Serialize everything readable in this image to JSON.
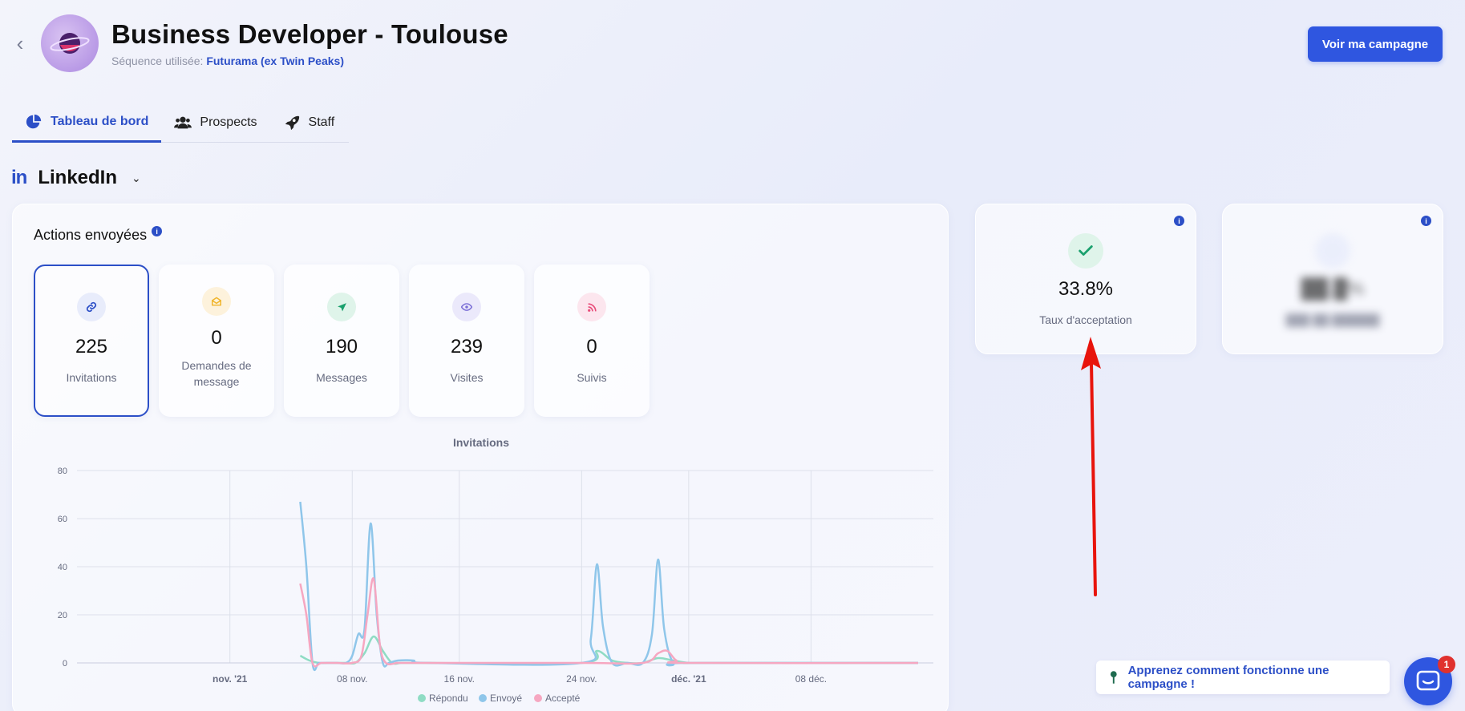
{
  "header": {
    "title": "Business Developer - Toulouse",
    "sequence_label": "Séquence utilisée:",
    "sequence_name": "Futurama (ex Twin Peaks)",
    "campaign_button": "Voir ma campagne"
  },
  "tabs": [
    {
      "label": "Tableau de bord",
      "icon": "pie-chart-icon",
      "active": true
    },
    {
      "label": "Prospects",
      "icon": "users-icon",
      "active": false
    },
    {
      "label": "Staff",
      "icon": "rocket-icon",
      "active": false
    }
  ],
  "channel": {
    "logo": "in",
    "name": "LinkedIn"
  },
  "actions": {
    "title": "Actions envoyées",
    "info": "i",
    "stats": [
      {
        "value": "225",
        "label": "Invitations",
        "icon": "link-icon",
        "color": "#2c4fc7"
      },
      {
        "value": "0",
        "label": "Demandes de message",
        "icon": "envelope-icon",
        "color": "#f0b429"
      },
      {
        "value": "190",
        "label": "Messages",
        "icon": "send-icon",
        "color": "#1aa06d"
      },
      {
        "value": "239",
        "label": "Visites",
        "icon": "eye-icon",
        "color": "#7b6fd6"
      },
      {
        "value": "0",
        "label": "Suivis",
        "icon": "rss-icon",
        "color": "#e84d7a"
      }
    ]
  },
  "kpis": [
    {
      "value": "33.8%",
      "label": "Taux d'acceptation",
      "icon": "check-icon"
    }
  ],
  "help": {
    "text": "Apprenez comment fonctionne une campagne !",
    "icon": "pin-icon"
  },
  "chat": {
    "badge": "1"
  },
  "colors": {
    "accent": "#2f56e0",
    "repondu": "#8fdcc4",
    "envoye": "#8fc6ea",
    "accepte": "#f6a7c1"
  },
  "chart_data": {
    "type": "line",
    "title": "Invitations",
    "ylim": [
      0,
      80
    ],
    "yticks": [
      0,
      20,
      40,
      60,
      80
    ],
    "xlim": [
      -10,
      46
    ],
    "x_ticks": [
      {
        "x": 0,
        "label": "nov. '21",
        "bold": true
      },
      {
        "x": 8,
        "label": "08 nov.",
        "bold": false
      },
      {
        "x": 15,
        "label": "16 nov.",
        "bold": false
      },
      {
        "x": 23,
        "label": "24 nov.",
        "bold": false
      },
      {
        "x": 30,
        "label": "déc. '21",
        "bold": true
      },
      {
        "x": 38,
        "label": "08 déc.",
        "bold": false
      }
    ],
    "x_day_labels": [
      "nov. '21",
      "08 nov.",
      "16 nov.",
      "24 nov.",
      "déc. '21",
      "08 déc."
    ],
    "series": [
      {
        "name": "Répondu",
        "color": "#8fdcc4",
        "x": [
          4.6,
          5.2,
          5.8,
          6.4,
          7.0,
          7.6,
          8.2,
          8.8,
          9.4,
          10.0,
          10.6,
          11.2,
          11.8,
          12.4,
          13.0,
          23.0,
          24.0,
          25.0,
          26.0,
          27.0,
          28.0,
          29.0,
          30.0,
          31.0,
          45.0
        ],
        "y": [
          3,
          1,
          0,
          0,
          0,
          0,
          0,
          4,
          11,
          5,
          0,
          0,
          0,
          0,
          0,
          0,
          5,
          1,
          0,
          0,
          2,
          1,
          0,
          0,
          0
        ]
      },
      {
        "name": "Envoyé",
        "color": "#8fc6ea",
        "x": [
          4.6,
          5.0,
          5.4,
          5.8,
          6.2,
          7.0,
          7.6,
          8.0,
          8.4,
          8.8,
          9.2,
          9.6,
          10.0,
          10.4,
          11.0,
          12.0,
          13.0,
          23.0,
          23.6,
          24.0,
          24.4,
          25.0,
          26.0,
          27.0,
          27.6,
          28.0,
          28.4,
          29.0,
          30.0,
          45.0
        ],
        "y": [
          67,
          40,
          0,
          0,
          0,
          0,
          0,
          3,
          12,
          14,
          58,
          20,
          0,
          0,
          1,
          1,
          0,
          0,
          10,
          41,
          15,
          0,
          0,
          0,
          12,
          43,
          14,
          0,
          0,
          0
        ]
      },
      {
        "name": "Accepté",
        "color": "#f6a7c1",
        "x": [
          4.6,
          5.0,
          5.4,
          6.0,
          7.0,
          8.0,
          8.6,
          9.0,
          9.4,
          9.8,
          10.2,
          11.0,
          12.0,
          23.0,
          27.0,
          28.0,
          28.6,
          29.2,
          30.0,
          45.0
        ],
        "y": [
          33,
          20,
          0,
          0,
          0,
          0,
          3,
          20,
          35,
          8,
          0,
          0,
          0,
          0,
          0,
          4,
          5,
          1,
          0,
          0
        ]
      }
    ]
  }
}
